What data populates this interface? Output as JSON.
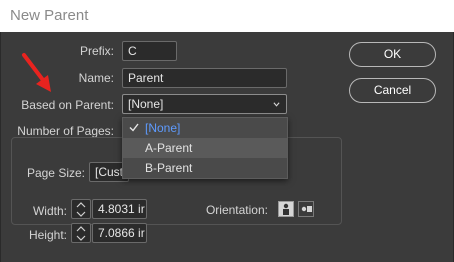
{
  "window": {
    "title": "New Parent"
  },
  "form": {
    "prefix_label": "Prefix:",
    "prefix_value": "C",
    "name_label": "Name:",
    "name_value": "Parent",
    "based_on_label": "Based on Parent:",
    "based_on_value": "[None]",
    "num_pages_label": "Number of Pages:",
    "page_size_label": "Page Size:",
    "page_size_value": "[Cust",
    "width_label": "Width:",
    "width_value": "4.8031 ir",
    "height_label": "Height:",
    "height_value": "7.0866 ir",
    "orientation_label": "Orientation:"
  },
  "buttons": {
    "ok": "OK",
    "cancel": "Cancel"
  },
  "dropdown": {
    "items": [
      "[None]",
      "A-Parent",
      "B-Parent"
    ],
    "selected_index": 0,
    "hover_index": 1
  },
  "colors": {
    "dialog_bg": "#3b3b3b",
    "selected_text": "#5e9bff",
    "annotation_arrow": "#e8231f"
  },
  "icons": [
    "check-icon",
    "chevron-down-icon",
    "stepper-icon",
    "portrait-orientation-icon",
    "landscape-orientation-icon",
    "annotation-arrow"
  ]
}
